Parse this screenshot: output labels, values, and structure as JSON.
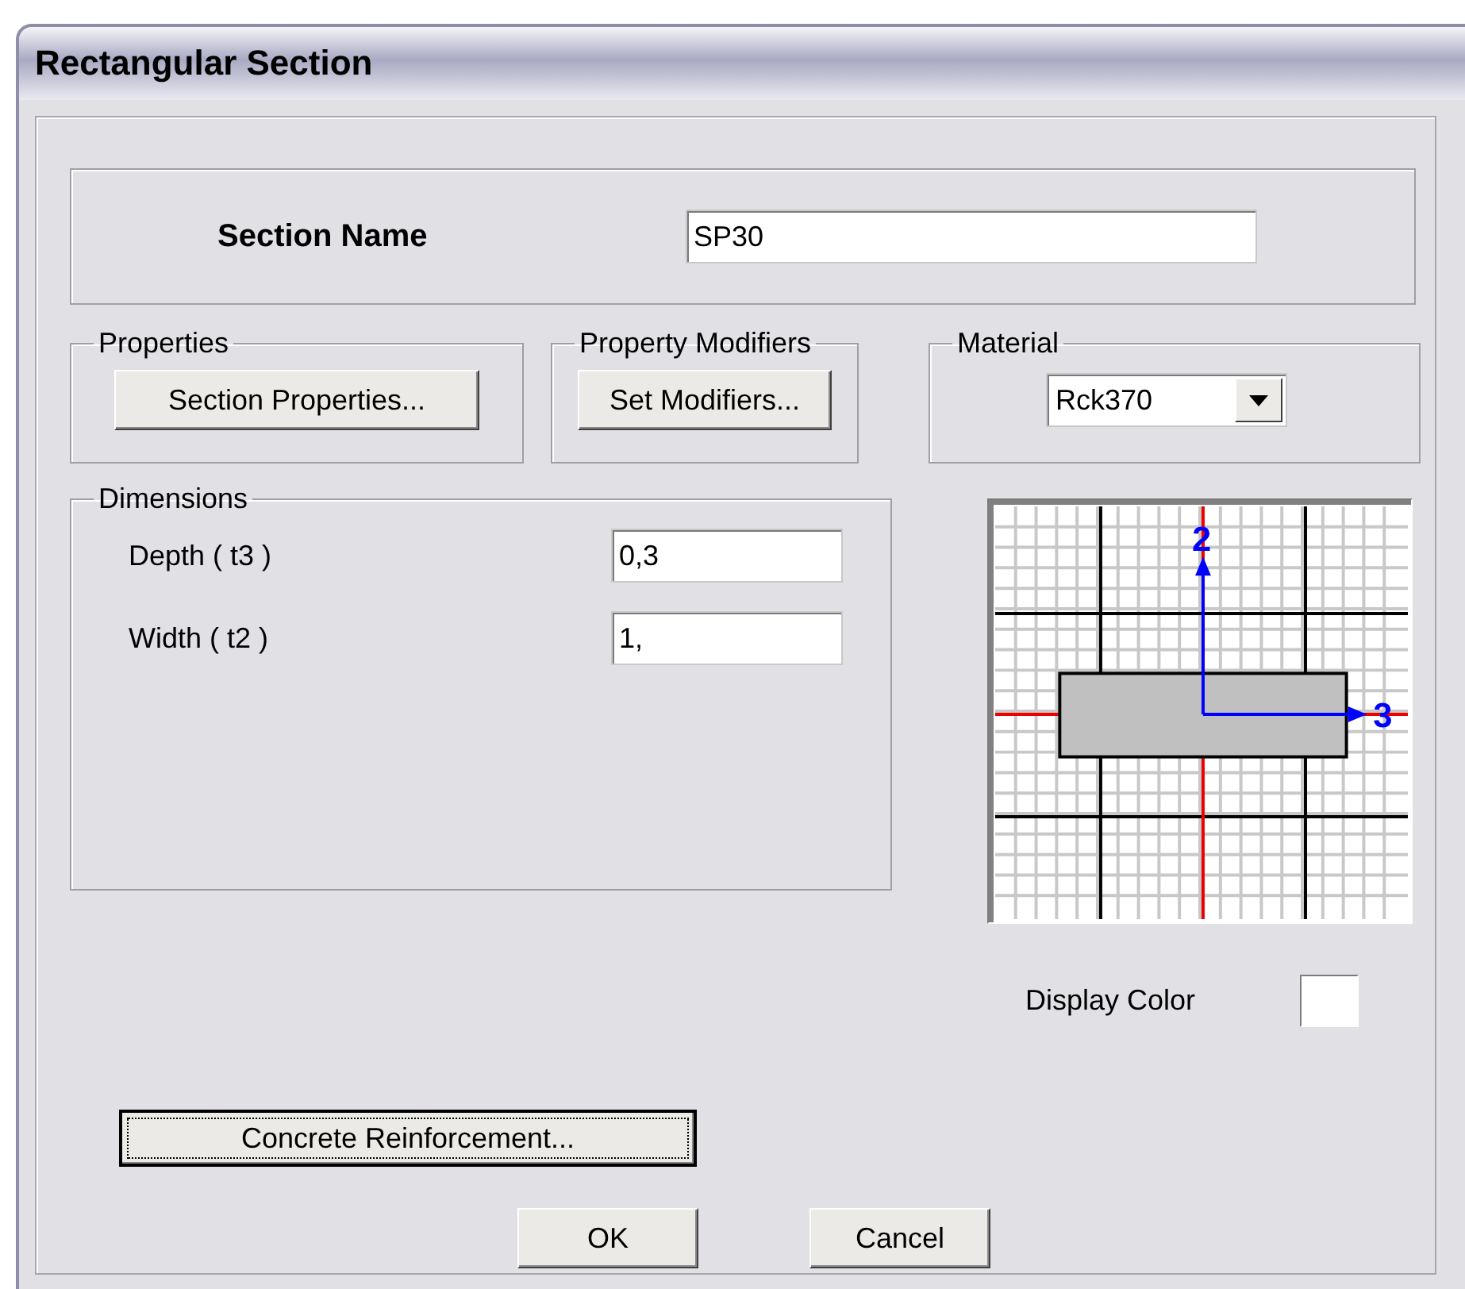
{
  "window": {
    "title": "Rectangular Section"
  },
  "section_name": {
    "label": "Section Name",
    "value": "SP30"
  },
  "properties": {
    "title": "Properties",
    "button": "Section Properties..."
  },
  "property_modifiers": {
    "title": "Property Modifiers",
    "button": "Set Modifiers..."
  },
  "material": {
    "title": "Material",
    "value": "Rck370"
  },
  "dimensions": {
    "title": "Dimensions",
    "fields": [
      {
        "label": "Depth ( t3 )",
        "value": "0,3"
      },
      {
        "label": "Width ( t2 )",
        "value": "1,"
      }
    ]
  },
  "section_diagram": {
    "axis_labels": [
      "2",
      "3"
    ]
  },
  "display_color": {
    "label": "Display Color",
    "color": "#ffffff"
  },
  "buttons": [
    {
      "label": "Concrete Reinforcement...",
      "focused": true
    },
    {
      "label": "OK",
      "focused": false
    },
    {
      "label": "Cancel",
      "focused": false
    }
  ]
}
